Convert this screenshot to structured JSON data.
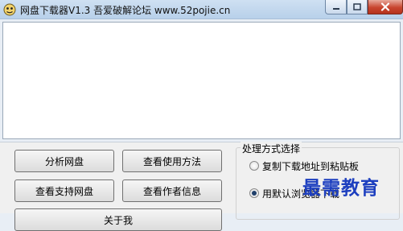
{
  "window": {
    "title": "网盘下载器V1.3    吾爱破解论坛 www.52pojie.cn",
    "controls": [
      "minimize-icon",
      "maximize-icon",
      "close-icon"
    ]
  },
  "log_area": {
    "content": ""
  },
  "buttons": {
    "analyze": "分析网盘",
    "usage": "查看使用方法",
    "supported": "查看支持网盘",
    "author": "查看作者信息",
    "partial": "关于我"
  },
  "processing": {
    "title": "处理方式选择",
    "options": [
      "复制下载地址到粘贴板",
      "用默认浏览器下载"
    ],
    "selected_index": 1
  },
  "watermark": "最需教育"
}
